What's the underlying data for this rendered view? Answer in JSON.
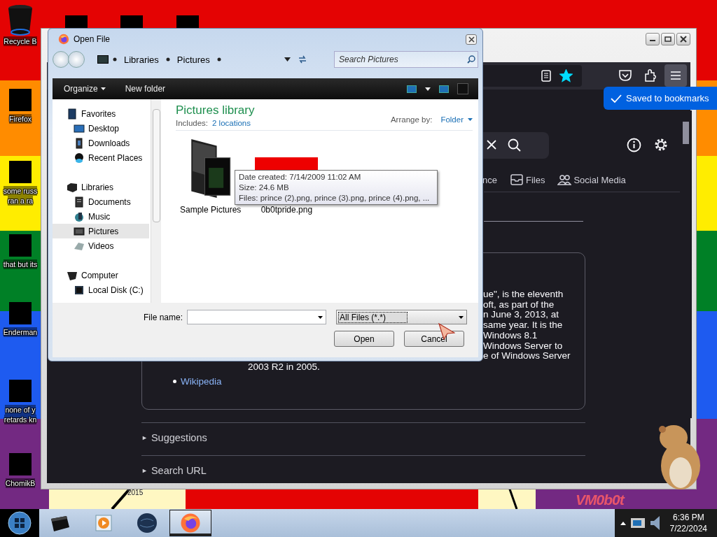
{
  "desktop": {
    "icons": [
      {
        "kind": "trash",
        "lines": [
          "Recycle B"
        ]
      },
      {
        "kind": "app",
        "lines": [
          "Firefox"
        ]
      },
      {
        "kind": "app",
        "lines": [
          "some russ",
          "ran a ra"
        ]
      },
      {
        "kind": "app",
        "lines": [
          "that but its"
        ]
      },
      {
        "kind": "app",
        "lines": [
          "Enderman"
        ]
      },
      {
        "kind": "app",
        "lines": [
          "none of y",
          "retards kn"
        ]
      },
      {
        "kind": "app",
        "lines": [
          "ChomikB"
        ]
      }
    ],
    "wallpaper_texts": [
      "2015",
      "VM0b0t"
    ]
  },
  "browser": {
    "bookmarked": true,
    "notification": "Saved to bookmarks",
    "tabs": [
      {
        "kind": "plain",
        "label": "nce"
      },
      {
        "kind": "files",
        "label": "Files"
      },
      {
        "kind": "people",
        "label": "Social Media"
      }
    ],
    "article_lines": [
      "ue\", is the eleventh",
      "oft, as part of the",
      "n June 3, 2013, at",
      "same year. It is the",
      "Windows 8.1",
      "Windows Server to",
      "e of Windows Server"
    ],
    "article_last_line": "2003 R2 in 2005.",
    "links": [
      "Wikipedia"
    ],
    "sections": [
      {
        "toggle": "►",
        "label": "Suggestions"
      },
      {
        "toggle": "►",
        "label": "Search URL"
      }
    ]
  },
  "dialog": {
    "title": "Open File",
    "breadcrumb": [
      "Libraries",
      "Pictures"
    ],
    "search": {
      "placeholder": "Search Pictures"
    },
    "toolbar": [
      {
        "kind": "menu",
        "label": "Organize"
      },
      {
        "kind": "button",
        "label": "New folder"
      }
    ],
    "nav": [
      {
        "kind": "favorites",
        "label": "Favorites",
        "selected": false,
        "children": [
          {
            "kind": "desktop",
            "label": "Desktop",
            "selected": false
          },
          {
            "kind": "downloads",
            "label": "Downloads",
            "selected": false
          },
          {
            "kind": "recent",
            "label": "Recent Places",
            "selected": false
          }
        ]
      },
      {
        "kind": "libraries",
        "label": "Libraries",
        "selected": false,
        "children": [
          {
            "kind": "documents",
            "label": "Documents",
            "selected": false
          },
          {
            "kind": "music",
            "label": "Music",
            "selected": false
          },
          {
            "kind": "pictures",
            "label": "Pictures",
            "selected": true
          },
          {
            "kind": "videos",
            "label": "Videos",
            "selected": false
          }
        ]
      },
      {
        "kind": "computer",
        "label": "Computer",
        "selected": false,
        "children": [
          {
            "kind": "disk",
            "label": "Local Disk (C:)",
            "selected": false
          }
        ]
      }
    ],
    "library": {
      "title": "Pictures library",
      "includes_label": "Includes:",
      "includes_link": "2 locations",
      "arrange_label": "Arrange by:",
      "arrange_value": "Folder"
    },
    "items": [
      {
        "kind": "folder",
        "name": "Sample Pictures"
      },
      {
        "kind": "image",
        "name": "0b0tpride.png"
      }
    ],
    "file_name_label": "File name:",
    "file_type": "All Files (*.*)",
    "buttons": [
      "Open",
      "Cancel"
    ]
  },
  "tooltip": [
    "Date created: 7/14/2009 11:02 AM",
    "Size: 24.6 MB",
    "Files: prince (2).png, prince (3).png, prince (4).png, ..."
  ],
  "taskbar": {
    "apps": [
      {
        "kind": "explorer",
        "active": false
      },
      {
        "kind": "media",
        "active": false
      },
      {
        "kind": "globe",
        "active": false
      },
      {
        "kind": "firefox",
        "active": true
      }
    ],
    "clock": {
      "time": "6:36 PM",
      "date": "7/22/2024"
    }
  }
}
